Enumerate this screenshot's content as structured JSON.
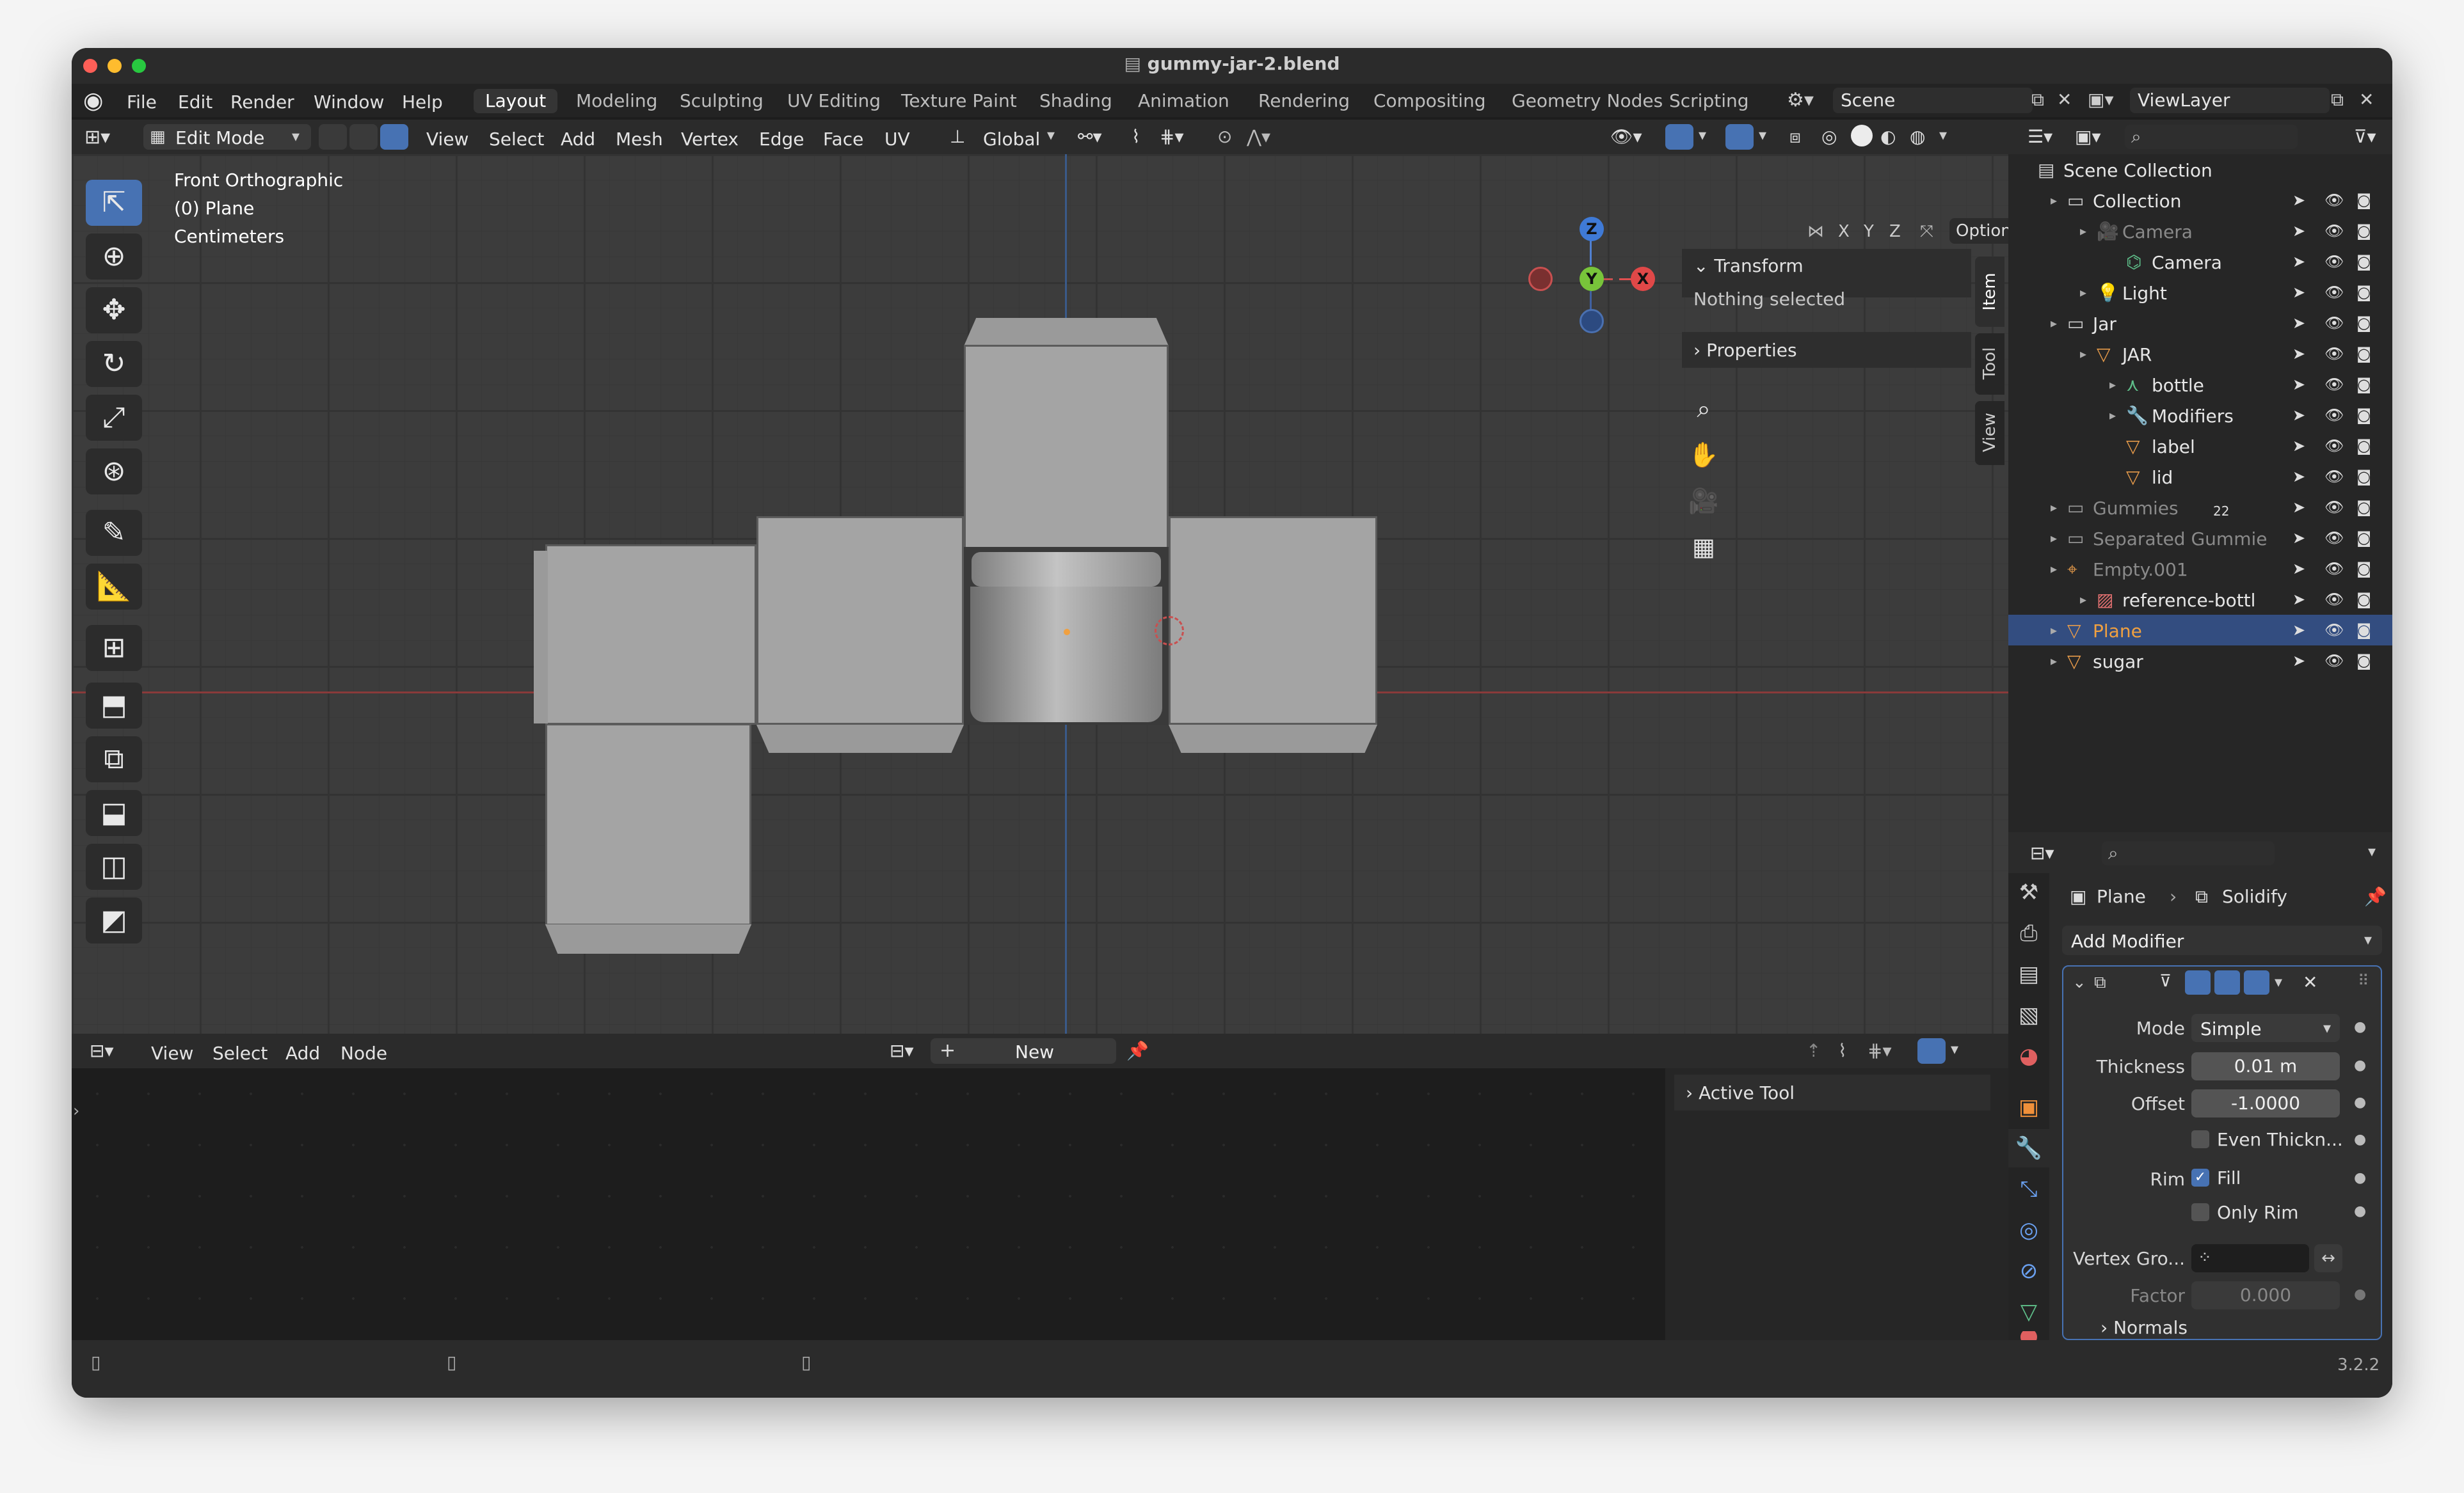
{
  "window": {
    "title": "gummy-jar-2.blend"
  },
  "menus": [
    "File",
    "Edit",
    "Render",
    "Window",
    "Help"
  ],
  "workspaces": [
    "Layout",
    "Modeling",
    "Sculpting",
    "UV Editing",
    "Texture Paint",
    "Shading",
    "Animation",
    "Rendering",
    "Compositing",
    "Geometry Nodes",
    "Scripting"
  ],
  "active_workspace": "Layout",
  "scene": {
    "name": "Scene",
    "view_layer": "ViewLayer"
  },
  "viewport_header": {
    "mode": "Edit Mode",
    "menus": [
      "View",
      "Select",
      "Add",
      "Mesh",
      "Vertex",
      "Edge",
      "Face",
      "UV"
    ],
    "transform_orientation": "Global",
    "axes": [
      "X",
      "Y",
      "Z"
    ],
    "options": "Options"
  },
  "viewport": {
    "view_name": "Front Orthographic",
    "object": "(0) Plane",
    "units": "Centimeters",
    "gizmo": {
      "z": "Z",
      "y": "Y",
      "x": "X"
    }
  },
  "npanel": {
    "transform": "Transform",
    "nothing_selected": "Nothing selected",
    "properties": "Properties",
    "tabs": [
      "Item",
      "Tool",
      "View"
    ]
  },
  "node_editor": {
    "menus": [
      "View",
      "Select",
      "Add",
      "Node"
    ],
    "new_label": "New",
    "active_tool": "Active Tool"
  },
  "outliner": {
    "rows": [
      {
        "name": "Scene Collection",
        "indent": 0,
        "icon": "scene-collection-icon",
        "color": "#cccccc",
        "muted": false,
        "selected": false
      },
      {
        "name": "Collection",
        "indent": 1,
        "icon": "collection-icon",
        "color": "#cccccc",
        "muted": false,
        "selected": false
      },
      {
        "name": "Camera",
        "indent": 2,
        "icon": "camera-icon",
        "color": "#e59a4a",
        "muted": true,
        "selected": false
      },
      {
        "name": "Camera",
        "indent": 3,
        "icon": "camera-data-icon",
        "color": "#5fbf8a",
        "muted": false,
        "selected": false
      },
      {
        "name": "Light",
        "indent": 2,
        "icon": "light-icon",
        "color": "#e59a4a",
        "muted": false,
        "selected": false
      },
      {
        "name": "Jar",
        "indent": 1,
        "icon": "collection-icon",
        "color": "#cccccc",
        "muted": false,
        "selected": false
      },
      {
        "name": "JAR",
        "indent": 2,
        "icon": "mesh-object-icon",
        "color": "#e59a4a",
        "muted": false,
        "selected": false
      },
      {
        "name": "bottle",
        "indent": 3,
        "icon": "mesh-data-icon",
        "color": "#5fbf8a",
        "muted": false,
        "selected": false
      },
      {
        "name": "Modifiers",
        "indent": 3,
        "icon": "wrench-icon",
        "color": "#7aa3e0",
        "muted": false,
        "selected": false
      },
      {
        "name": "label",
        "indent": 3,
        "icon": "mesh-object-icon",
        "color": "#e59a4a",
        "muted": false,
        "selected": false
      },
      {
        "name": "lid",
        "indent": 3,
        "icon": "mesh-object-icon",
        "color": "#e59a4a",
        "muted": false,
        "selected": false
      },
      {
        "name": "Gummies",
        "indent": 1,
        "icon": "collection-icon",
        "color": "#9a9a9a",
        "muted": true,
        "selected": false,
        "badge": "22"
      },
      {
        "name": "Separated Gummie",
        "indent": 1,
        "icon": "collection-icon",
        "color": "#9a9a9a",
        "muted": true,
        "selected": false
      },
      {
        "name": "Empty.001",
        "indent": 1,
        "icon": "empty-icon",
        "color": "#e59a4a",
        "muted": true,
        "selected": false
      },
      {
        "name": "reference-bottl",
        "indent": 2,
        "icon": "image-icon",
        "color": "#e07070",
        "muted": false,
        "selected": false
      },
      {
        "name": "Plane",
        "indent": 1,
        "icon": "mesh-object-icon",
        "color": "#e59a4a",
        "muted": false,
        "selected": true
      },
      {
        "name": "sugar",
        "indent": 1,
        "icon": "mesh-object-icon",
        "color": "#e59a4a",
        "muted": false,
        "selected": false
      }
    ]
  },
  "properties": {
    "breadcrumb_object": "Plane",
    "breadcrumb_modifier": "Solidify",
    "add_modifier": "Add Modifier",
    "fields": {
      "mode_label": "Mode",
      "mode_value": "Simple",
      "thickness_label": "Thickness",
      "thickness_value": "0.01 m",
      "offset_label": "Offset",
      "offset_value": "-1.0000",
      "even_thickness": "Even Thickn...",
      "rim_label": "Rim",
      "fill": "Fill",
      "only_rim": "Only Rim",
      "vertex_group_label": "Vertex Gro...",
      "factor_label": "Factor",
      "factor_value": "0.000",
      "normals": "Normals"
    }
  },
  "status": {
    "version": "3.2.2"
  },
  "colors": {
    "accent": "#4772b3",
    "selection": "#334d80",
    "object": "#e59a4a",
    "data": "#5fbf8a"
  }
}
